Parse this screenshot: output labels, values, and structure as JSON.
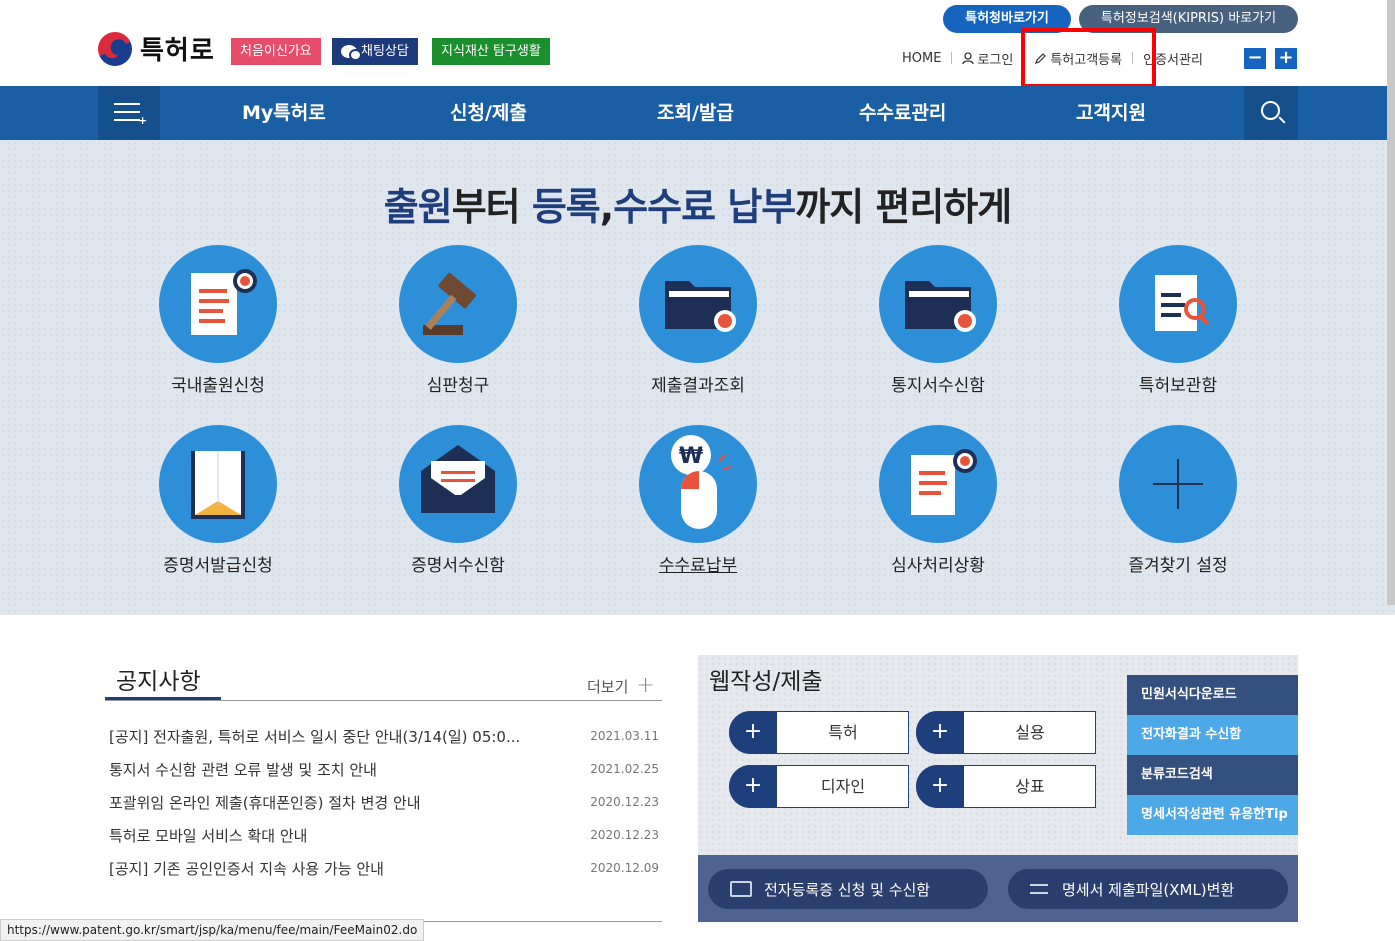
{
  "header": {
    "logo_text": "특허로",
    "btn_first_visit": "처음이신가요",
    "btn_chat": "채팅상담",
    "btn_ip_life": "지식재산 탐구생활",
    "pill_kipo": "특허청바로가기",
    "pill_kipris": "특허정보검색(KIPRIS) 바로가기",
    "util_home": "HOME",
    "util_login": "로그인",
    "util_register": "특허고객등록",
    "util_cert": "인증서관리",
    "zoom_out": "−",
    "zoom_in": "+"
  },
  "nav": {
    "items": [
      "My특허로",
      "신청/제출",
      "조회/발급",
      "수수료관리",
      "고객지원"
    ]
  },
  "hero": {
    "headline_parts": [
      "출원",
      "부터 ",
      "등록",
      ",",
      "수수료 납부",
      "까지 편리하게"
    ],
    "services": [
      {
        "label": "국내출원신청",
        "icon": "application-doc-icon"
      },
      {
        "label": "심판청구",
        "icon": "gavel-icon"
      },
      {
        "label": "제출결과조회",
        "icon": "folder-result-icon"
      },
      {
        "label": "통지서수신함",
        "icon": "folder-notice-icon"
      },
      {
        "label": "특허보관함",
        "icon": "doc-search-icon"
      },
      {
        "label": "증명서발급신청",
        "icon": "envelope-cert-icon"
      },
      {
        "label": "증명서수신함",
        "icon": "mail-icon"
      },
      {
        "label": "수수료납부",
        "icon": "won-mouse-icon"
      },
      {
        "label": "심사처리상황",
        "icon": "doc-badge-icon"
      },
      {
        "label": "즐겨찾기 설정",
        "icon": "plus-icon"
      }
    ]
  },
  "notice": {
    "title": "공지사항",
    "more": "더보기",
    "items": [
      {
        "text": "[공지] 전자출원, 특허로 서비스 일시 중단 안내(3/14(일) 05:0...",
        "date": "2021.03.11"
      },
      {
        "text": "통지서 수신함 관련 오류 발생 및 조치 안내",
        "date": "2021.02.25"
      },
      {
        "text": "포괄위임 온라인 제출(휴대폰인증) 절차 변경 안내",
        "date": "2020.12.23"
      },
      {
        "text": "특허로 모바일 서비스 확대 안내",
        "date": "2020.12.23"
      },
      {
        "text": "[공지] 기존 공인인증서 지속 사용 가능 안내",
        "date": "2020.12.09"
      }
    ]
  },
  "web": {
    "title": "웹작성/제출",
    "buttons": [
      "특허",
      "실용",
      "디자인",
      "상표"
    ],
    "side_links": [
      "민원서식다운로드",
      "전자화결과 수신함",
      "분류코드검색",
      "명세서작성관련 유용한Tip"
    ],
    "footer_left": "전자등록증 신청 및 수신함",
    "footer_right": "명세서 제출파일(XML)변환"
  },
  "status_url": "https://www.patent.go.kr/smart/jsp/ka/menu/fee/main/FeeMain02.do",
  "colors": {
    "nav": "#1a5ea4",
    "navy": "#1e3f7c",
    "accent_blue": "#2e8fd9",
    "highlight": "#ff0000"
  }
}
